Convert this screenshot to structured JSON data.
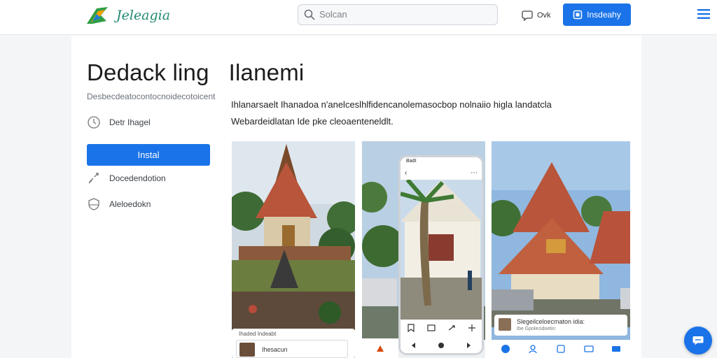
{
  "header": {
    "brand": "Jeleagia",
    "search_placeholder": "Solcan",
    "ask_label": "Ovk",
    "primary_label": "Insdeahy"
  },
  "main": {
    "title_part1": "Dedack ling",
    "title_part2": "Ilanemi",
    "subtitle": "Desbecdeatocontocnoidecotoicent",
    "description_line1": "Ihlanarsaelt Ihanadoa n'anelceslhlfidencanolemasocbop nolnaiio higla landatcla",
    "description_line2": "Webardeidlatan Ide pke cleoaenteneldlt."
  },
  "sidebar": {
    "item1_label": "Detr Ihagel",
    "install_label": "Instal",
    "item2_label": "Docedendotion",
    "item3_label": "Aleloedokn"
  },
  "gallery": {
    "shot1_card_header": "Ihaded  Indeabt",
    "shot1_card_title": "Ihesacun",
    "shot2_status": "Badt",
    "shot3_card_text": "Slegeilceloecmaton idia:",
    "shot3_card_sub": "Ibe Gpolecidoetin:"
  },
  "colors": {
    "accent": "#1a73e8",
    "brand": "#1f8a70",
    "roof": "#b8553a"
  },
  "icons": {
    "logo": "leaf-flag-logo",
    "search": "search-icon",
    "ask": "chat-icon",
    "menu": "hamburger-icon",
    "fab": "chat-icon"
  }
}
